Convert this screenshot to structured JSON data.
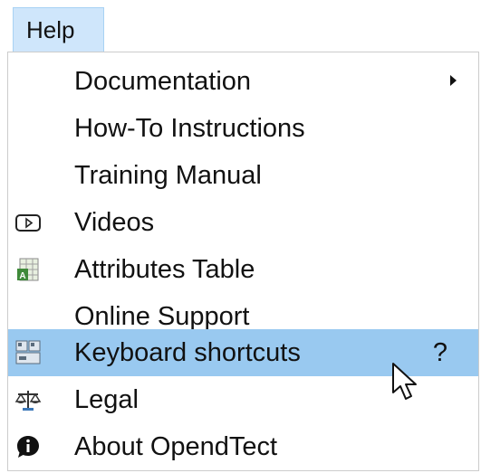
{
  "menubar": {
    "help_label": "Help"
  },
  "menu": {
    "items": [
      {
        "label": "Documentation",
        "icon": "",
        "has_submenu": true
      },
      {
        "label": "How-To Instructions",
        "icon": ""
      },
      {
        "label": "Training Manual",
        "icon": ""
      },
      {
        "label": "Videos",
        "icon": "play-video-icon"
      },
      {
        "label": "Attributes Table",
        "icon": "spreadsheet-icon"
      },
      {
        "label": "Online Support",
        "icon": ""
      },
      {
        "label": "Keyboard shortcuts",
        "icon": "keyboard-icon",
        "shortcut": "?",
        "highlighted": true
      },
      {
        "label": "Legal",
        "icon": "scales-icon"
      },
      {
        "label": "About OpendTect",
        "icon": "info-bubble-icon"
      }
    ]
  },
  "colors": {
    "menubar_highlight": "#cfe6fb",
    "item_highlight": "#99c9f0"
  }
}
